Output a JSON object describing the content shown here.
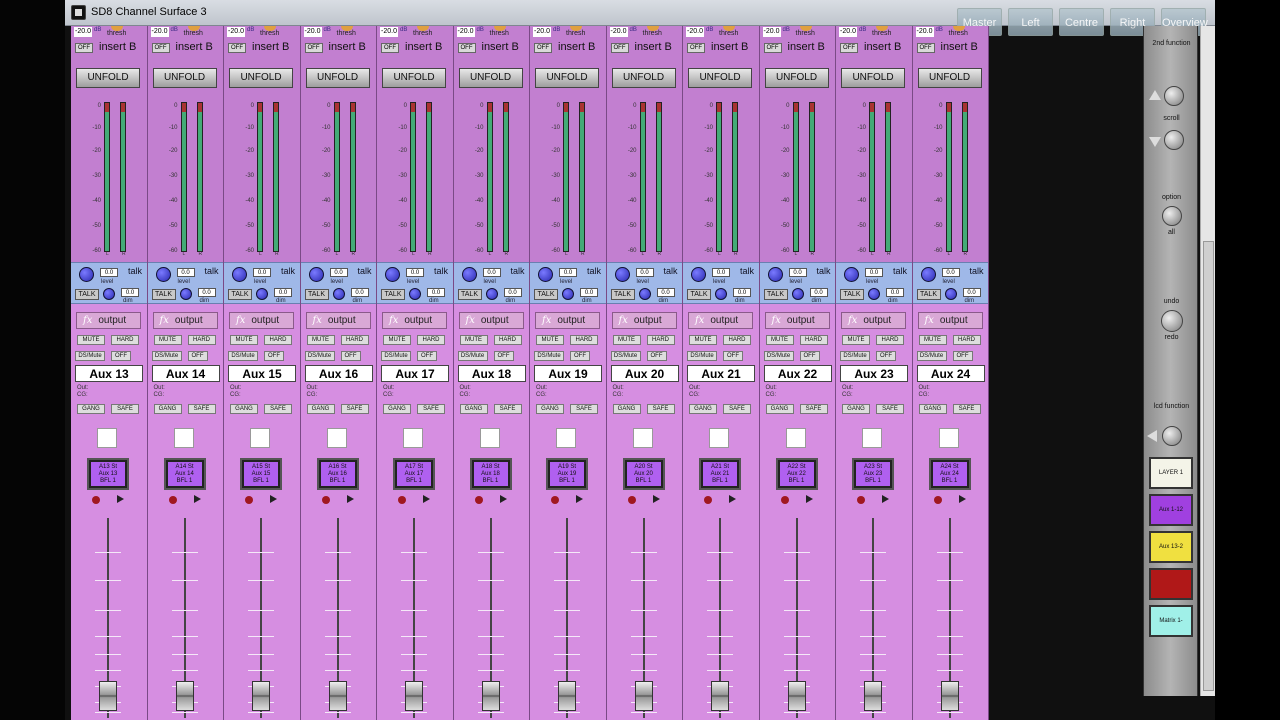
{
  "window": {
    "title": "SD8 Channel Surface 3"
  },
  "header_buttons": [
    "Master",
    "Left",
    "Centre",
    "Right",
    "Overview"
  ],
  "strip_common": {
    "threshold_value": "-20.0",
    "threshold_unit": "dB",
    "thresh_label": "thresh",
    "off_label": "OFF",
    "insert_label": "insert B",
    "unfold_label": "UNFOLD",
    "meter_scale": [
      "0",
      "-10",
      "-20",
      "-30",
      "-40",
      "-50",
      "-60"
    ],
    "meter_left": "L",
    "meter_right": "R",
    "talk_word": "talk",
    "talk_level_value": "0.0",
    "talk_level_label": "level",
    "talk_button": "TALK",
    "dim_value": "0.0",
    "dim_label": "dim",
    "fx_glyph": "fx",
    "output_label": "output",
    "mute_label": "MUTE",
    "hard_label": "HARD",
    "dsmute_label": "DS/Mute",
    "off2_label": "OFF",
    "out_label": "Out:",
    "cg_label": "CG:",
    "gang_label": "GANG",
    "safe_label": "SAFE"
  },
  "strips": [
    {
      "name": "Aux 13",
      "lcd": [
        "A13 St",
        "Aux 13",
        "BFL 1"
      ]
    },
    {
      "name": "Aux 14",
      "lcd": [
        "A14 St",
        "Aux 14",
        "BFL 1"
      ]
    },
    {
      "name": "Aux 15",
      "lcd": [
        "A15 St",
        "Aux 15",
        "BFL 1"
      ]
    },
    {
      "name": "Aux 16",
      "lcd": [
        "A16 St",
        "Aux 16",
        "BFL 1"
      ]
    },
    {
      "name": "Aux 17",
      "lcd": [
        "A17 St",
        "Aux 17",
        "BFL 1"
      ]
    },
    {
      "name": "Aux 18",
      "lcd": [
        "A18 St",
        "Aux 18",
        "BFL 1"
      ]
    },
    {
      "name": "Aux 19",
      "lcd": [
        "A19 St",
        "Aux 19",
        "BFL 1"
      ]
    },
    {
      "name": "Aux 20",
      "lcd": [
        "A20 St",
        "Aux 20",
        "BFL 1"
      ]
    },
    {
      "name": "Aux 21",
      "lcd": [
        "A21 St",
        "Aux 21",
        "BFL 1"
      ]
    },
    {
      "name": "Aux 22",
      "lcd": [
        "A22 St",
        "Aux 22",
        "BFL 1"
      ]
    },
    {
      "name": "Aux 23",
      "lcd": [
        "A23 St",
        "Aux 23",
        "BFL 1"
      ]
    },
    {
      "name": "Aux 24",
      "lcd": [
        "A24 St",
        "Aux 24",
        "BFL 1"
      ]
    }
  ],
  "right_panel": {
    "second_function": "2nd function",
    "scroll": "scroll",
    "option": "option",
    "all": "all",
    "undo": "undo",
    "redo": "redo",
    "lcd_function": "lcd function",
    "layer_buttons": [
      {
        "label": "LAYER 1",
        "color": "#f4f4e8"
      },
      {
        "label": "Aux 1-12",
        "color": "#a040e0"
      },
      {
        "label": "Aux 13-2",
        "color": "#f0e040"
      },
      {
        "label": "",
        "color": "#b01818"
      },
      {
        "label": "Matrix 1-",
        "color": "#a0f0e8"
      }
    ]
  }
}
